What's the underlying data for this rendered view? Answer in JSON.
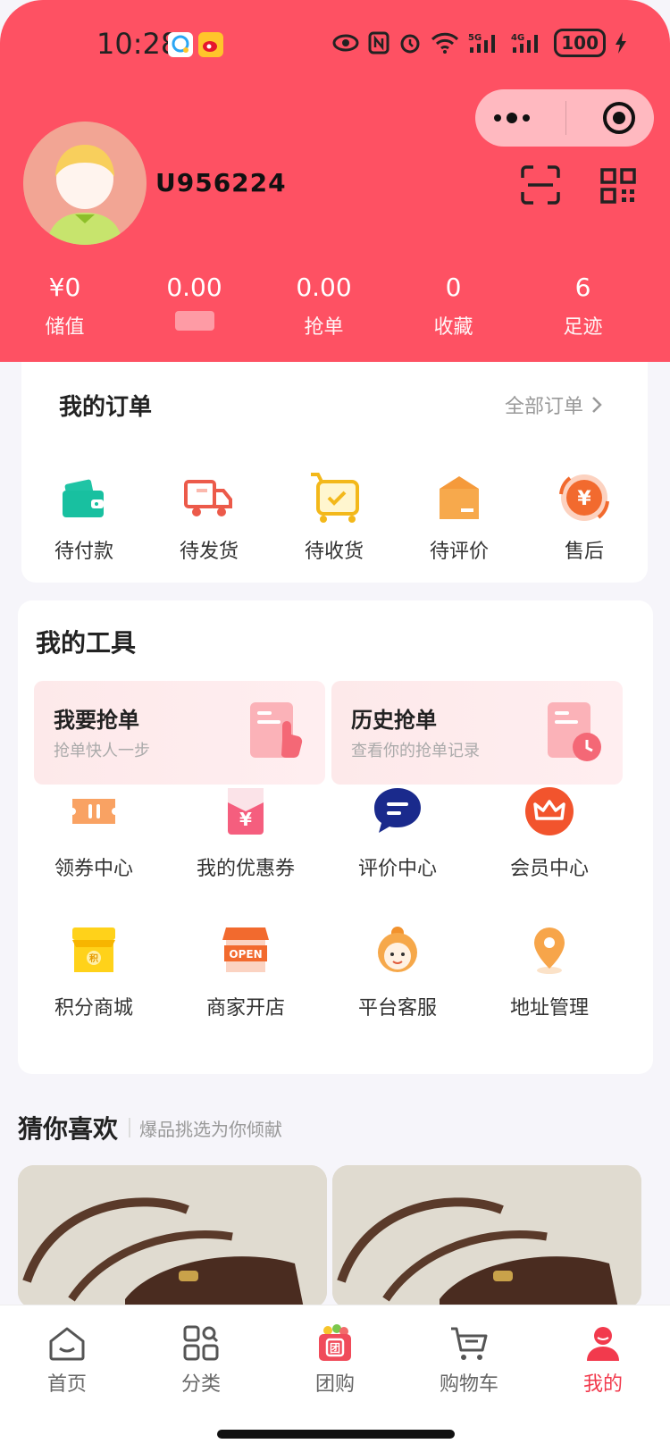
{
  "status_bar": {
    "time": "10:28",
    "battery": "100"
  },
  "profile": {
    "username": "U956224"
  },
  "stats": [
    {
      "value": "¥0",
      "label": "储值"
    },
    {
      "value": "0.00",
      "label": ""
    },
    {
      "value": "0.00",
      "label": "抢单"
    },
    {
      "value": "0",
      "label": "收藏"
    },
    {
      "value": "6",
      "label": "足迹"
    }
  ],
  "orders": {
    "title": "我的订单",
    "all_label": "全部订单",
    "items": [
      {
        "label": "待付款",
        "icon": "wallet-icon"
      },
      {
        "label": "待发货",
        "icon": "truck-icon"
      },
      {
        "label": "待收货",
        "icon": "box-check-icon"
      },
      {
        "label": "待评价",
        "icon": "package-icon"
      },
      {
        "label": "售后",
        "icon": "yen-refund-icon"
      }
    ]
  },
  "tools": {
    "title": "我的工具",
    "promos": [
      {
        "title": "我要抢单",
        "subtitle": "抢单快人一步"
      },
      {
        "title": "历史抢单",
        "subtitle": "查看你的抢单记录"
      }
    ],
    "grid": [
      {
        "label": "领券中心",
        "icon": "ticket-icon"
      },
      {
        "label": "我的优惠券",
        "icon": "coupon-icon"
      },
      {
        "label": "评价中心",
        "icon": "chat-icon"
      },
      {
        "label": "会员中心",
        "icon": "crown-icon"
      },
      {
        "label": "积分商城",
        "icon": "store-icon"
      },
      {
        "label": "商家开店",
        "icon": "open-shop-icon"
      },
      {
        "label": "平台客服",
        "icon": "support-icon"
      },
      {
        "label": "地址管理",
        "icon": "location-icon"
      }
    ]
  },
  "guess": {
    "title": "猜你喜欢",
    "subtitle": "爆品挑选为你倾献"
  },
  "tabbar": [
    {
      "label": "首页",
      "icon": "home-icon"
    },
    {
      "label": "分类",
      "icon": "category-icon"
    },
    {
      "label": "团购",
      "icon": "group-buy-icon"
    },
    {
      "label": "购物车",
      "icon": "cart-icon"
    },
    {
      "label": "我的",
      "icon": "profile-icon",
      "active": true
    }
  ],
  "colors": {
    "header": "#fe5163",
    "active_tab": "#f23a4d"
  }
}
